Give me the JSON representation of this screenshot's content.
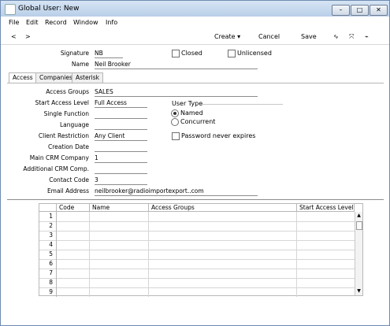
{
  "window": {
    "title": "Global User: New"
  },
  "menubar": [
    "File",
    "Edit",
    "Record",
    "Window",
    "Info"
  ],
  "toolbar": {
    "back": "<",
    "forward": ">",
    "create": "Create",
    "cancel": "Cancel",
    "save": "Save"
  },
  "header": {
    "signature_label": "Signature",
    "signature_value": "NB",
    "name_label": "Name",
    "name_value": "Neil Brooker",
    "closed_label": "Closed",
    "unlicensed_label": "Unlicensed"
  },
  "tabs": [
    "Access",
    "Companies",
    "Asterisk"
  ],
  "access": {
    "access_groups_label": "Access Groups",
    "access_groups_value": "SALES",
    "start_access_level_label": "Start Access Level",
    "start_access_level_value": "Full Access",
    "single_function_label": "Single Function",
    "single_function_value": "",
    "language_label": "Language",
    "language_value": "",
    "client_restriction_label": "Client Restriction",
    "client_restriction_value": "Any Client",
    "creation_date_label": "Creation Date",
    "creation_date_value": "",
    "main_crm_company_label": "Main CRM Company",
    "main_crm_company_value": "1",
    "additional_crm_comp_label": "Additional CRM Comp.",
    "additional_crm_comp_value": "",
    "contact_code_label": "Contact Code",
    "contact_code_value": "3",
    "email_address_label": "Email Address",
    "email_address_value": "neilbrooker@radioimportexport..com",
    "user_type_label": "User Type",
    "named_label": "Named",
    "concurrent_label": "Concurrent",
    "password_never_expires_label": "Password never expires"
  },
  "grid": {
    "headers": [
      "Code",
      "Name",
      "Access Groups",
      "Start Access Level"
    ],
    "rows": [
      "1",
      "2",
      "3",
      "4",
      "5",
      "6",
      "7",
      "8",
      "9"
    ]
  }
}
